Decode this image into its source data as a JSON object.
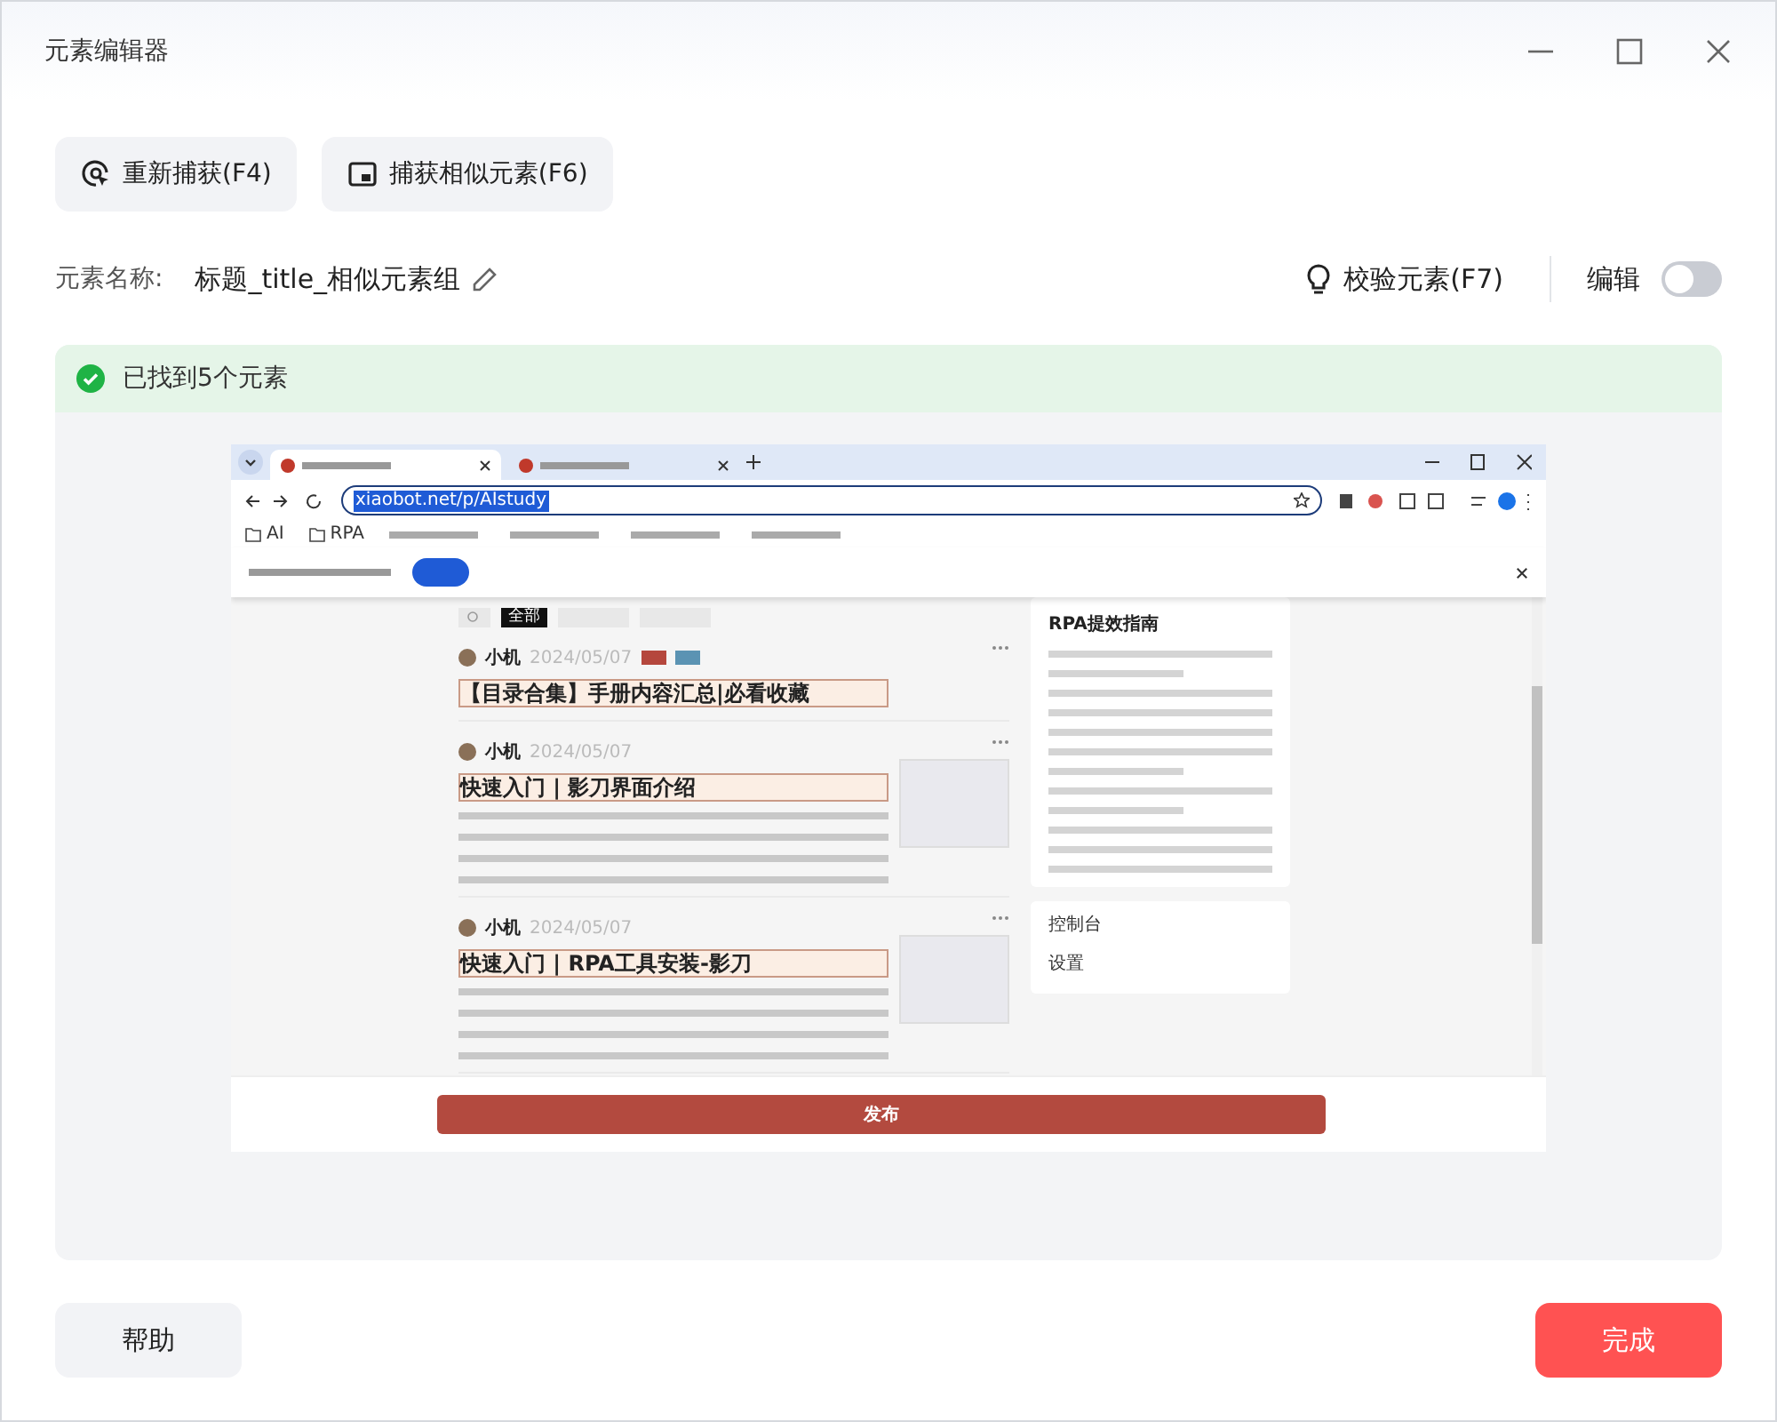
{
  "window": {
    "title": "元素编辑器"
  },
  "toolbar": [
    {
      "kind": "recapture",
      "label": "重新捕获(F4)"
    },
    {
      "kind": "similar",
      "label": "捕获相似元素(F6)"
    }
  ],
  "element_name": {
    "label": "元素名称:",
    "value": "标题_title_相似元素组"
  },
  "validate_button": {
    "label": "校验元素(F7)"
  },
  "edit_toggle": {
    "label": "编辑",
    "on": false
  },
  "result_banner": {
    "text": "已找到5个元素"
  },
  "preview": {
    "tabs": [
      {
        "selected": true
      },
      {
        "selected": false
      }
    ],
    "address": "xiaobot.net/p/AIstudy",
    "bookmarks": [
      {
        "label": "AI"
      },
      {
        "label": "RPA"
      }
    ],
    "filter_chips": [
      {
        "label": "全部",
        "selected": true
      },
      {
        "selected": false
      },
      {
        "selected": false
      }
    ],
    "posts": [
      {
        "author": "小机",
        "date": "2024/05/07",
        "tags": [
          {
            "color": "#b5473d"
          },
          {
            "color": "#5b93b3"
          }
        ],
        "title": "【目录合集】手册内容汇总|必看收藏",
        "highlighted": true,
        "excerpt": false,
        "thumbnail": false
      },
      {
        "author": "小机",
        "date": "2024/05/07",
        "title": "快速入门 | 影刀界面介绍",
        "highlighted": true,
        "excerpt": true,
        "thumbnail": true
      },
      {
        "author": "小机",
        "date": "2024/05/07",
        "title": "快速入门 | RPA工具安装-影刀",
        "highlighted": true,
        "excerpt": true,
        "thumbnail": true
      }
    ],
    "side_panel": {
      "title": "RPA提效指南",
      "menu": [
        "控制台",
        "设置"
      ]
    },
    "publish_button": "发布"
  },
  "footer": {
    "help": "帮助",
    "done": "完成"
  }
}
